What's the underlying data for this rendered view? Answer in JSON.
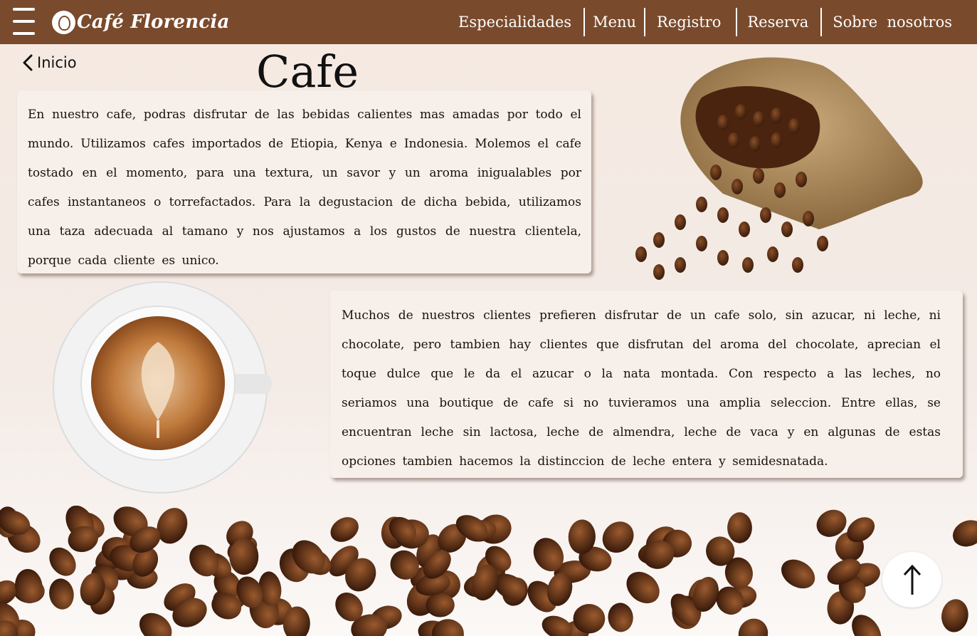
{
  "header": {
    "brand_name": "Café Florencia",
    "nav": [
      {
        "label": "Especialidades"
      },
      {
        "label": "Menu"
      },
      {
        "label": "Registro"
      },
      {
        "label": "Reserva"
      },
      {
        "label": "Sobre  nosotros"
      }
    ]
  },
  "back": {
    "label": "Inicio"
  },
  "page": {
    "title": "Cafe",
    "paragraph1": "En nuestro cafe, podras disfrutar de las bebidas calientes mas amadas por todo el mundo. Utilizamos cafes importados de Etiopia, Kenya e Indonesia. Molemos el cafe tostado en el momento, para una textura, un savor y un aroma inigualables por cafes instantaneos o torrefactados. Para la degustacion de dicha bebida, utilizamos una taza adecuada al tamano y nos ajustamos a los gustos de nuestra clientela, porque cada cliente es unico.",
    "paragraph2": "Muchos de nuestros clientes prefieren disfrutar de un cafe solo, sin azucar, ni leche, ni chocolate, pero tambien hay clientes que disfrutan del aroma del chocolate, aprecian el toque dulce que le da el azucar o la nata montada. Con respecto a las leches, no seriamos una boutique de cafe si no tuvieramos una amplia seleccion. Entre ellas, se encuentran leche sin lactosa, leche de almendra, leche de vaca y en algunas de estas opciones tambien hacemos la distinccion de leche entera y semidesnatada."
  },
  "icons": {
    "menu": "hamburger-icon",
    "back": "chevron-left-icon",
    "scroll_top": "arrow-up-icon"
  },
  "colors": {
    "header_bg": "#7a4a2c",
    "page_bg": "#f5e9e1",
    "card_bg": "#f7efea",
    "bean": "#5a3018"
  }
}
